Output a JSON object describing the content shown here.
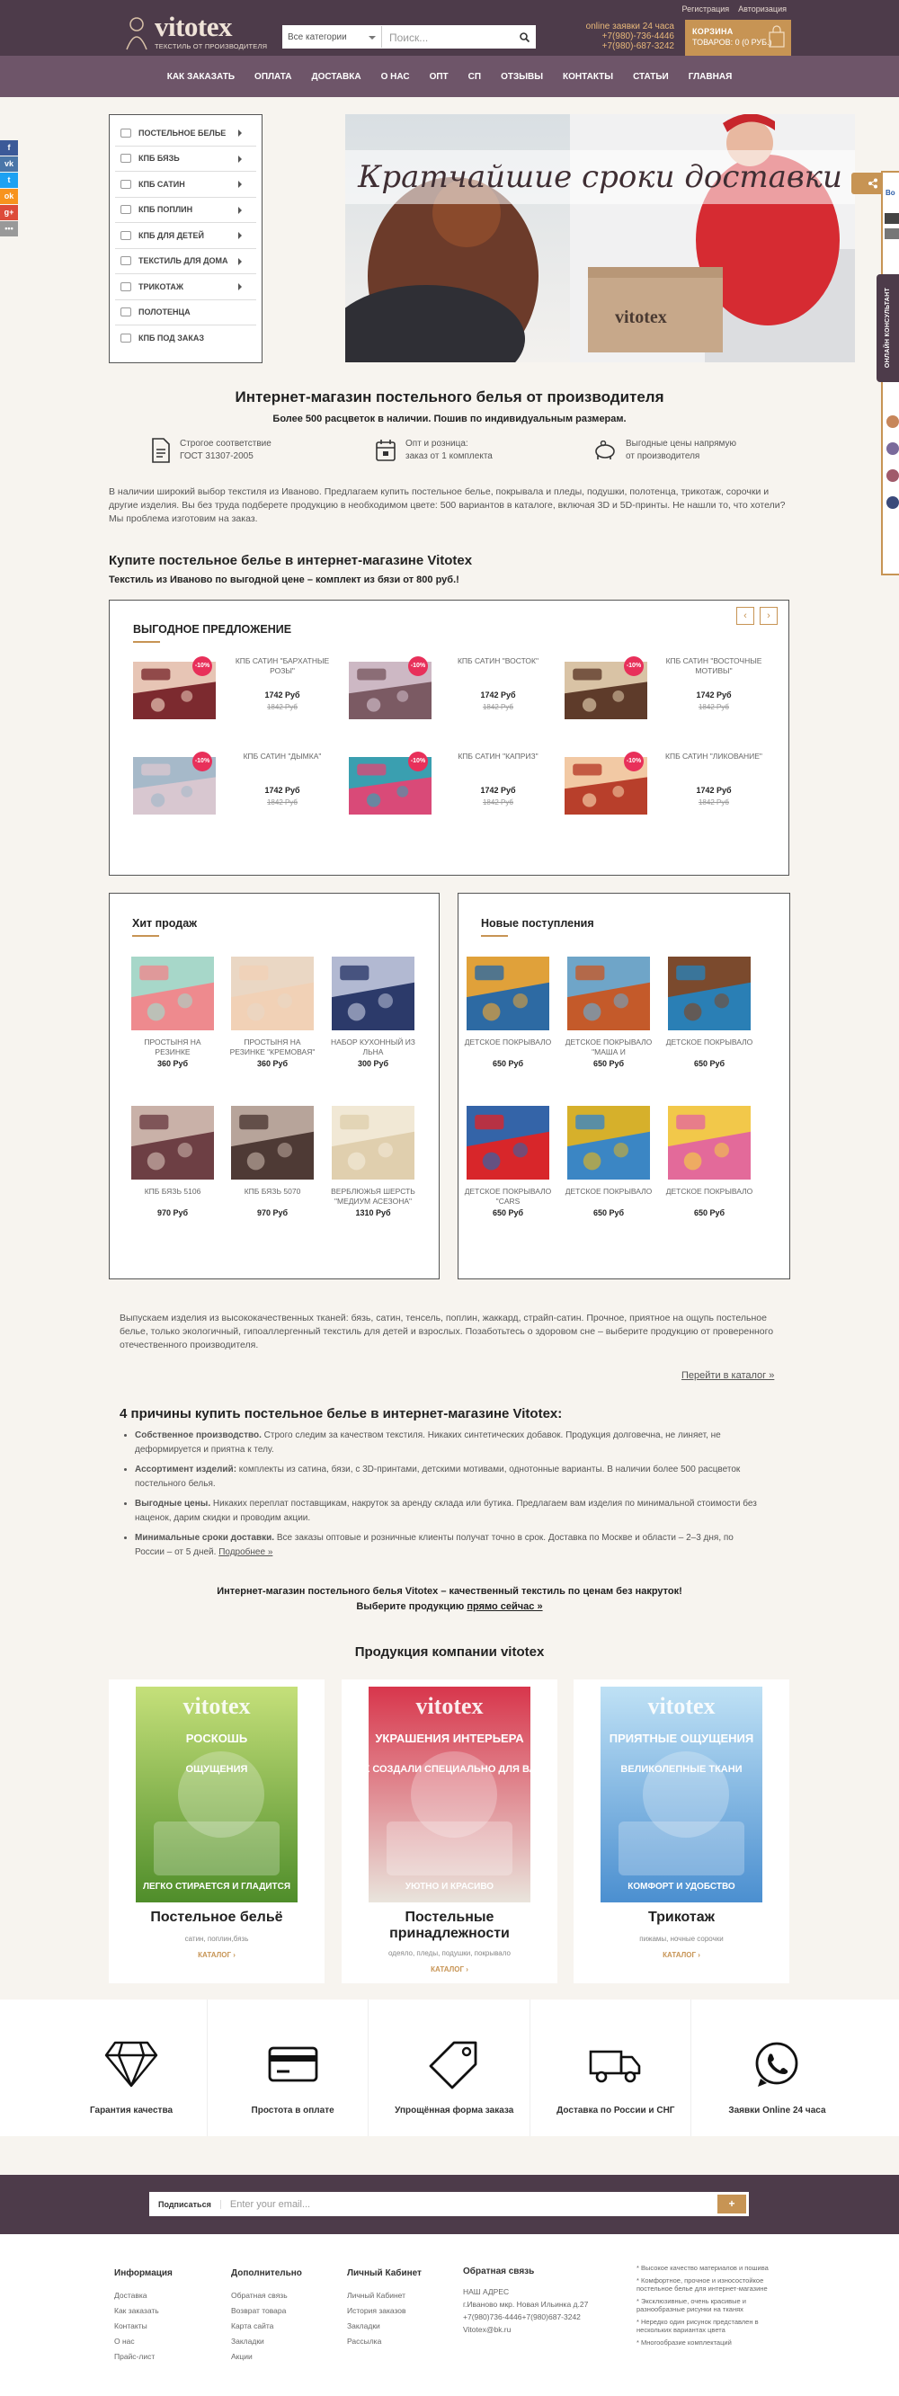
{
  "header": {
    "toplinks": [
      "Регистрация",
      "Авторизация"
    ],
    "logo": {
      "word": "vitotex",
      "tagline": "ТЕКСТИЛЬ ОТ ПРОИЗВОДИТЕЛЯ"
    },
    "search": {
      "category": "Все категории",
      "placeholder": "Поиск..."
    },
    "phones": {
      "label": "online заявки 24 часа",
      "phone1": "+7(980)-736-4446",
      "phone2": "+7(980)-687-3242"
    },
    "cart": {
      "title": "КОРЗИНА",
      "summary": "ТОВАРОВ: 0 (0 РУБ.)"
    }
  },
  "nav": [
    "КАК ЗАКАЗАТЬ",
    "ОПЛАТА",
    "ДОСТАВКА",
    "О НАС",
    "ОПТ",
    "СП",
    "ОТЗЫВЫ",
    "КОНТАКТЫ",
    "СТАТЬИ",
    "ГЛАВНАЯ"
  ],
  "social": [
    {
      "glyph": "f",
      "color": "#3b5998"
    },
    {
      "glyph": "vk",
      "color": "#4a76a8"
    },
    {
      "glyph": "t",
      "color": "#1da1f2"
    },
    {
      "glyph": "ok",
      "color": "#f7931e"
    },
    {
      "glyph": "g+",
      "color": "#dd4b39"
    },
    {
      "glyph": "•••",
      "color": "#999999"
    }
  ],
  "catalog_menu": [
    "ПОСТЕЛЬНОЕ БЕЛЬЕ",
    "КПБ БЯЗЬ",
    "КПБ САТИН",
    "КПБ ПОПЛИН",
    "КПБ ДЛЯ ДЕТЕЙ",
    "ТЕКСТИЛЬ ДЛЯ ДОМА",
    "ТРИКОТАЖ",
    "ПОЛОТЕНЦА",
    "КПБ ПОД ЗАКАЗ"
  ],
  "hero": {
    "caption": "Кратчайшие сроки доставки",
    "box_brand": "vitotex"
  },
  "right_widget": {
    "tab": "ОНЛАЙН КОНСУЛЬТАНТ",
    "label": "Во"
  },
  "intro": {
    "title": "Интернет-магазин постельного белья от производителя",
    "subtitle": "Более 500 расцветок в наличии. Пошив по индивидуальным размерам.",
    "features": [
      {
        "icon": "document-icon",
        "line1": "Строгое соответствие",
        "line2": "ГОСТ 31307-2005"
      },
      {
        "icon": "calendar-icon",
        "line1": "Опт и розница:",
        "line2": "заказ от 1 комплекта"
      },
      {
        "icon": "piggy-bank-icon",
        "line1": "Выгодные цены напрямую",
        "line2": "от производителя"
      }
    ],
    "text": "В наличии широкий выбор текстиля из Иваново. Предлагаем купить постельное белье, покрывала и пледы, подушки, полотенца, трикотаж, сорочки и другие изделия. Вы без труда подберете продукцию в необходимом цвете: 500 вариантов в каталоге, включая 3D и 5D-принты. Не нашли то, что хотели? Мы проблема изготовим на заказ."
  },
  "buy": {
    "title": "Купите постельное белье в интернет-магазине Vitotex",
    "subtitle": "Текстиль из Иваново по выгодной цене – комплект из бязи от 800 руб.!"
  },
  "offer": {
    "title": "ВЫГОДНОЕ ПРЕДЛОЖЕНИЕ",
    "prev": "‹",
    "next": "›",
    "items": [
      {
        "name": "КПБ САТИН \"БАРХАТНЫЕ РОЗЫ\"",
        "price": "1742 Руб",
        "old": "1842 Руб",
        "badge": "-10%",
        "c1": "#7c2a2f",
        "c2": "#e7c5b5"
      },
      {
        "name": "КПБ САТИН \"ВОСТОК\"",
        "price": "1742 Руб",
        "old": "1842 Руб",
        "badge": "-10%",
        "c1": "#7b5a63",
        "c2": "#cdb8c4"
      },
      {
        "name": "КПБ САТИН \"ВОСТОЧНЫЕ МОТИВЫ\"",
        "price": "1742 Руб",
        "old": "1842 Руб",
        "badge": "-10%",
        "c1": "#5e3b2a",
        "c2": "#d9c3a5"
      },
      {
        "name": "КПБ САТИН \"ДЫМКА\"",
        "price": "1742 Руб",
        "old": "1842 Руб",
        "badge": "-10%",
        "c1": "#d8c7d0",
        "c2": "#a6b9c9"
      },
      {
        "name": "КПБ САТИН \"КАПРИЗ\"",
        "price": "1742 Руб",
        "old": "1842 Руб",
        "badge": "-10%",
        "c1": "#d94a78",
        "c2": "#3a9fb0"
      },
      {
        "name": "КПБ САТИН \"ЛИКОВАНИЕ\"",
        "price": "1742 Руб",
        "old": "1842 Руб",
        "badge": "-10%",
        "c1": "#b83f2b",
        "c2": "#f2c9a4"
      }
    ]
  },
  "hits": {
    "title": "Хит продаж",
    "items": [
      {
        "name": "ПРОСТЫНЯ НА РЕЗИНКЕ",
        "price": "360 Руб",
        "c1": "#ee8a8e",
        "c2": "#a7d7c9"
      },
      {
        "name": "ПРОСТЫНЯ НА РЕЗИНКЕ \"КРЕМОВАЯ\"",
        "price": "360 Руб",
        "c1": "#f1d1b6",
        "c2": "#ead7c4"
      },
      {
        "name": "НАБОР КУХОННЫЙ ИЗ ЛЬНА",
        "price": "300 Руб",
        "c1": "#2c3a6a",
        "c2": "#b2b9d2"
      },
      {
        "name": "КПБ БЯЗЬ 5106",
        "price": "970 Руб",
        "c1": "#6d3f44",
        "c2": "#c9b1a8"
      },
      {
        "name": "КПБ БЯЗЬ 5070",
        "price": "970 Руб",
        "c1": "#4e3a35",
        "c2": "#b7a49a"
      },
      {
        "name": "ВЕРБЛЮЖЬЯ ШЕРСТЬ \"МЕДИУМ АСЕЗОНА\"",
        "price": "1310 Руб",
        "c1": "#e0cfae",
        "c2": "#f1e8d5"
      }
    ]
  },
  "news": {
    "title": "Новые поступления",
    "items": [
      {
        "name": "ДЕТСКОЕ ПОКРЫВАЛО",
        "price": "650 Руб",
        "c1": "#2d6aa3",
        "c2": "#e0a13a"
      },
      {
        "name": "ДЕТСКОЕ ПОКРЫВАЛО \"МАША И",
        "price": "650 Руб",
        "c1": "#c45a2a",
        "c2": "#6fa5c8"
      },
      {
        "name": "ДЕТСКОЕ ПОКРЫВАЛО",
        "price": "650 Руб",
        "c1": "#2a7fb5",
        "c2": "#7b4a2d"
      },
      {
        "name": "ДЕТСКОЕ ПОКРЫВАЛО \"CARS",
        "price": "650 Руб",
        "c1": "#d8262a",
        "c2": "#3464a8"
      },
      {
        "name": "ДЕТСКОЕ ПОКРЫВАЛО",
        "price": "650 Руб",
        "c1": "#3b86c4",
        "c2": "#d6b02b"
      },
      {
        "name": "ДЕТСКОЕ ПОКРЫВАЛО",
        "price": "650 Руб",
        "c1": "#e36a9a",
        "c2": "#f2c84a"
      }
    ]
  },
  "about": {
    "text": "Выпускаем изделия из высококачественных тканей: бязь, сатин, тенсель, поплин, жаккард, страйп-сатин. Прочное, приятное на ощупь постельное белье, только экологичный, гипоаллергенный текстиль для детей и взрослых. Позаботьтесь о здоровом сне – выберите продукцию от проверенного отечественного производителя.",
    "link": "Перейти в каталог »"
  },
  "reasons": {
    "title": "4 причины купить постельное белье в интернет-магазине Vitotex:",
    "items": [
      {
        "bold": "Собственное производство.",
        "text": " Строго следим за качеством текстиля. Никаких синтетических добавок. Продукция долговечна, не линяет, не деформируется и приятна к телу."
      },
      {
        "bold": "Ассортимент изделий:",
        "text": " комплекты из сатина, бязи, с 3D-принтами, детскими мотивами, однотонные варианты. В наличии более 500 расцветок постельного белья."
      },
      {
        "bold": "Выгодные цены.",
        "text": " Никаких переплат поставщикам, накруток за аренду склада или бутика. Предлагаем вам изделия по минимальной стоимости без наценок, дарим скидки и проводим акции."
      },
      {
        "bold": "Минимальные сроки доставки.",
        "text": " Все заказы оптовые и розничные клиенты получат точно в срок. Доставка по Москве и области – 2–3 дня, по России – от 5 дней. "
      }
    ],
    "more": "Подробнее »"
  },
  "cta": {
    "line1": "Интернет-магазин постельного белья Vitotex – качественный текстиль по ценам без накруток!",
    "line2_pre": "Выберите продукцию ",
    "line2_link": "прямо сейчас »"
  },
  "products": {
    "title": "Продукция компании vitotex",
    "cards": [
      {
        "name": "Постельное бельё",
        "desc": "сатин, поплин,бязь",
        "link": "КАТАЛОГ ›",
        "brand": "vitotex",
        "t1": "РОСКОШЬ",
        "t2": "ОЩУЩЕНИЯ",
        "t3": "ЛЕГКО СТИРАЕТСЯ И ГЛАДИТСЯ",
        "bg1": "#4f8d2a",
        "bg2": "#c5e07a"
      },
      {
        "name": "Постельные принадлежности",
        "desc": "одеяло, пледы, подушки, покрывало",
        "link": "КАТАЛОГ ›",
        "brand": "vitotex",
        "t1": "УКРАШЕНИЯ ИНТЕРЬЕРА",
        "t2": "ИХ СОЗДАЛИ СПЕЦИАЛЬНО ДЛЯ ВАС",
        "t3": "УЮТНО И КРАСИВО",
        "bg1": "#e9e4dc",
        "bg2": "#d8364c"
      },
      {
        "name": "Трикотаж",
        "desc": "пижамы, ночные сорочки",
        "link": "КАТАЛОГ ›",
        "brand": "vitotex",
        "t1": "ПРИЯТНЫЕ ОЩУЩЕНИЯ",
        "t2": "ВЕЛИКОЛЕПНЫЕ ТКАНИ",
        "t3": "КОМФОРТ И УДОБСТВО",
        "bg1": "#4b8fd0",
        "bg2": "#bfe1f5"
      }
    ]
  },
  "benefits": [
    "Гарантия качества",
    "Простота в оплате",
    "Упрощённая форма заказа",
    "Доставка по России и СНГ",
    "Заявки Online 24 часа"
  ],
  "subscribe": {
    "label": "Подписаться",
    "placeholder": "Enter your email...",
    "button": "+"
  },
  "footer": {
    "cols": [
      {
        "title": "Информация",
        "links": [
          "Доставка",
          "Как заказать",
          "Контакты",
          "О нас",
          "Прайс-лист"
        ]
      },
      {
        "title": "Дополнительно",
        "links": [
          "Обратная связь",
          "Возврат товара",
          "Карта сайта",
          "Закладки",
          "Акции"
        ]
      },
      {
        "title": "Личный Кабинет",
        "links": [
          "Личный Кабинет",
          "История заказов",
          "Закладки",
          "Рассылка"
        ]
      }
    ],
    "contact": {
      "title": "Обратная связь",
      "lines": [
        "НАШ АДРЕС",
        "г.Иваново мкр. Новая Ильинка д.27",
        "+7(980)736-4446+7(980)687-3242",
        "Vitotex@bk.ru"
      ]
    },
    "notes": [
      "* Высокое качество материалов и пошива",
      "* Комфортное, прочное и износостойкое постельное белье для интернет-магазине",
      "* Эксклюзивные, очень красивые и разнообразные рисунки на тканях",
      "* Нередко один рисунок представлен в нескольких вариантах цвета",
      "* Многообразие комплектаций"
    ]
  }
}
